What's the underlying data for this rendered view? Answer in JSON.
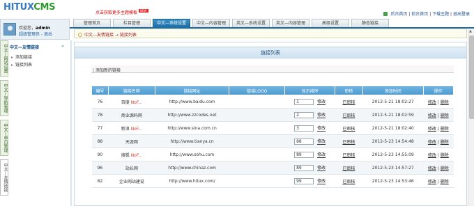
{
  "logo": {
    "part1": "HITUX",
    "part2": "CMS"
  },
  "promo": {
    "text": "点击获取更多主题模板",
    "badge": "NEW"
  },
  "top_links": {
    "home": "后台首页",
    "site_home": "前台首页",
    "download": "下载主题",
    "logout": "退出登录"
  },
  "tabs": [
    "管理首页",
    "栏目管理",
    "中文—系统设置",
    "中文—内容管理",
    "英文—系统设置",
    "英文—内容管理",
    "高级设置",
    "静态链接"
  ],
  "active_tab": 2,
  "user": {
    "welcome": "欢迎您，",
    "name": "admin",
    "role": "超级管理员 - 退出"
  },
  "breadcrumb": "中文—友情链接 → 链接列表",
  "side_tabs": [
    "中文—网站设置",
    "中文—导航管理",
    "中文—单页管理",
    "中文—友情链接"
  ],
  "menu": {
    "head": "中文—友情链接",
    "collapse": "«",
    "items": [
      "添加链接",
      "链接列表"
    ]
  },
  "panel_title": "链接列表",
  "add_link": "添加新的链接",
  "table": {
    "headers": [
      "编号",
      "链接名称",
      "链接网址",
      "链接LOGO",
      "显示排序",
      "审核",
      "添加时间",
      "操作"
    ],
    "rows": [
      {
        "id": "76",
        "name": "百度",
        "tag": "NoF...",
        "url": "http://www.baidu.com",
        "order": "1",
        "modify": "修改",
        "audit": "已审核",
        "time": "2012-5-21 18:02:27",
        "edit": "修改",
        "del": "删除"
      },
      {
        "id": "78",
        "name": "商业源码网",
        "tag": "",
        "url": "http://www.zzcodes.net",
        "order": "2",
        "modify": "修改",
        "audit": "已审核",
        "time": "2012-5-21 18:02:59",
        "edit": "修改",
        "del": "删除"
      },
      {
        "id": "77",
        "name": "新浪",
        "tag": "NoF...",
        "url": "http://www.sina.com.cn",
        "order": "3",
        "modify": "修改",
        "audit": "已审核",
        "time": "2012-5-21 18:02:40",
        "edit": "修改",
        "del": "删除"
      },
      {
        "id": "88",
        "name": "天涯网",
        "tag": "",
        "url": "http://www.tianya.cn",
        "order": "88",
        "modify": "修改",
        "audit": "已审核",
        "time": "2012-5-23 14:54:48",
        "edit": "修改",
        "del": "删除"
      },
      {
        "id": "90",
        "name": "搜狐",
        "tag": "NoF...",
        "url": "http://www.sohu.com",
        "order": "89",
        "modify": "修改",
        "audit": "已审核",
        "time": "2012-5-23 14:55:09",
        "edit": "修改",
        "del": "删除"
      },
      {
        "id": "96",
        "name": "站长网",
        "tag": "",
        "url": "http://www.chinaz.com",
        "order": "89",
        "modify": "修改",
        "audit": "已审核",
        "time": "2012-5-23 14:57:27",
        "edit": "修改",
        "del": "删除"
      },
      {
        "id": "82",
        "name": "企业网站建设",
        "tag": "",
        "url": "http://www.hitux.com/",
        "order": "99",
        "modify": "修改",
        "audit": "已审核",
        "time": "2012-5-23 14:53:46",
        "edit": "修改",
        "del": "删除"
      }
    ]
  }
}
